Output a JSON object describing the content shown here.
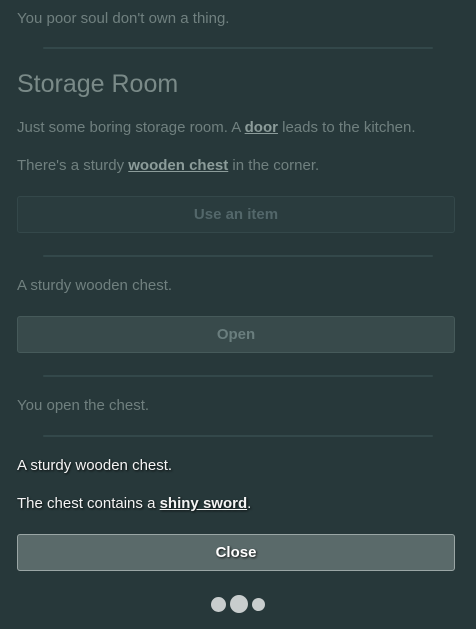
{
  "inventory": {
    "empty_text": "You poor soul don't own a thing."
  },
  "room": {
    "title": "Storage Room",
    "description_prefix": "Just some boring storage room. A ",
    "door_link": "door",
    "description_suffix": " leads to the kitchen.",
    "chest_prefix": "There's a sturdy ",
    "chest_link": "wooden chest",
    "chest_suffix": " in the corner.",
    "use_item_button": "Use an item"
  },
  "chest_examine": {
    "text": "A sturdy wooden chest.",
    "open_button": "Open"
  },
  "log": {
    "open_text": "You open the chest."
  },
  "chest_open": {
    "text": "A sturdy wooden chest.",
    "contains_prefix": "The chest contains a ",
    "item_link": "shiny sword",
    "contains_suffix": ".",
    "close_button": "Close"
  },
  "colors": {
    "background": "#27383a",
    "text_bright": "#f4f4f4",
    "text_dim": "#70807f",
    "button_active_bg": "#5a6a6a"
  },
  "loading_indicator": {
    "dots": 3
  }
}
